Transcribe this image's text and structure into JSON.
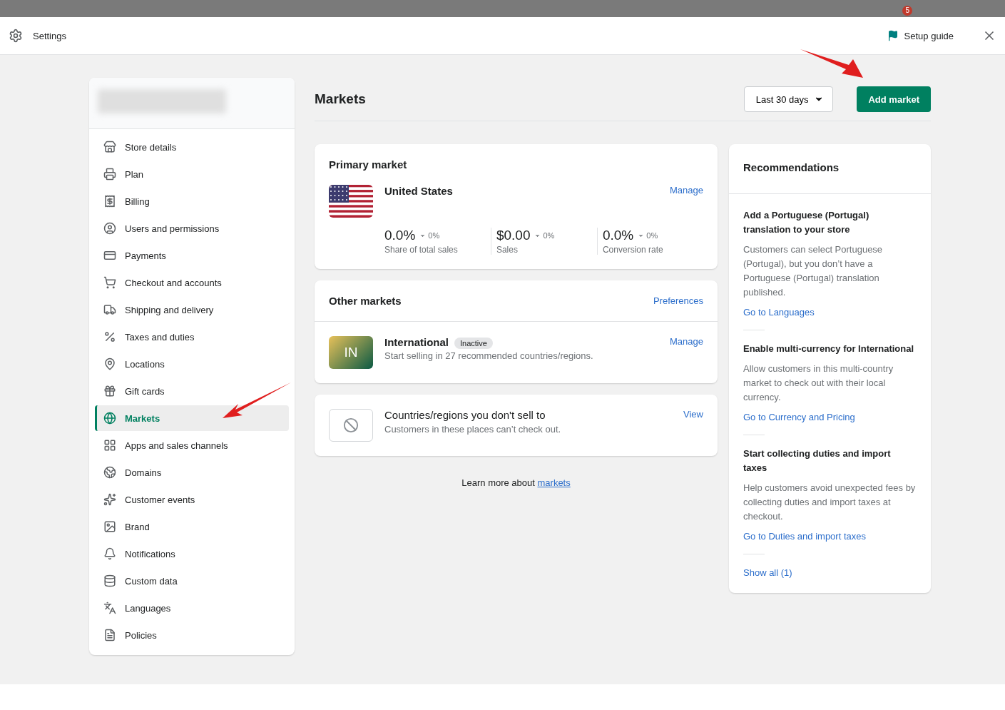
{
  "topbar": {
    "notification_count": "5"
  },
  "header": {
    "title": "Settings",
    "setup_guide": "Setup guide"
  },
  "sidebar": {
    "items": [
      {
        "label": "Store details",
        "selected": false
      },
      {
        "label": "Plan",
        "selected": false
      },
      {
        "label": "Billing",
        "selected": false
      },
      {
        "label": "Users and permissions",
        "selected": false
      },
      {
        "label": "Payments",
        "selected": false
      },
      {
        "label": "Checkout and accounts",
        "selected": false
      },
      {
        "label": "Shipping and delivery",
        "selected": false
      },
      {
        "label": "Taxes and duties",
        "selected": false
      },
      {
        "label": "Locations",
        "selected": false
      },
      {
        "label": "Gift cards",
        "selected": false
      },
      {
        "label": "Markets",
        "selected": true
      },
      {
        "label": "Apps and sales channels",
        "selected": false
      },
      {
        "label": "Domains",
        "selected": false
      },
      {
        "label": "Customer events",
        "selected": false
      },
      {
        "label": "Brand",
        "selected": false
      },
      {
        "label": "Notifications",
        "selected": false
      },
      {
        "label": "Custom data",
        "selected": false
      },
      {
        "label": "Languages",
        "selected": false
      },
      {
        "label": "Policies",
        "selected": false
      }
    ]
  },
  "page": {
    "title": "Markets",
    "date_range": "Last 30 days",
    "add_button": "Add market"
  },
  "primary_market": {
    "heading": "Primary market",
    "name": "United States",
    "action": "Manage",
    "metrics": [
      {
        "value": "0.0%",
        "change": "0%",
        "label": "Share of total sales"
      },
      {
        "value": "$0.00",
        "change": "0%",
        "label": "Sales"
      },
      {
        "value": "0.0%",
        "change": "0%",
        "label": "Conversion rate"
      }
    ]
  },
  "other_markets": {
    "heading": "Other markets",
    "action": "Preferences",
    "items": [
      {
        "initials": "IN",
        "name": "International",
        "badge": "Inactive",
        "description": "Start selling in 27 recommended countries/regions.",
        "action": "Manage"
      }
    ]
  },
  "excluded": {
    "title": "Countries/regions you don't sell to",
    "description": "Customers in these places can’t check out.",
    "action": "View"
  },
  "learn_more": {
    "text": "Learn more about ",
    "link": "markets"
  },
  "recommendations": {
    "heading": "Recommendations",
    "items": [
      {
        "title": "Add a Portuguese (Portugal) translation to your store",
        "body": "Customers can select Portuguese (Portugal), but you don’t have a Portuguese (Portugal) translation published.",
        "link": "Go to Languages"
      },
      {
        "title": "Enable multi-currency for International",
        "body": "Allow customers in this multi-country market to check out with their local currency.",
        "link": "Go to Currency and Pricing"
      },
      {
        "title": "Start collecting duties and import taxes",
        "body": "Help customers avoid unexpected fees by collecting duties and import taxes at checkout.",
        "link": "Go to Duties and import taxes"
      }
    ],
    "show_all": "Show all (1)"
  }
}
